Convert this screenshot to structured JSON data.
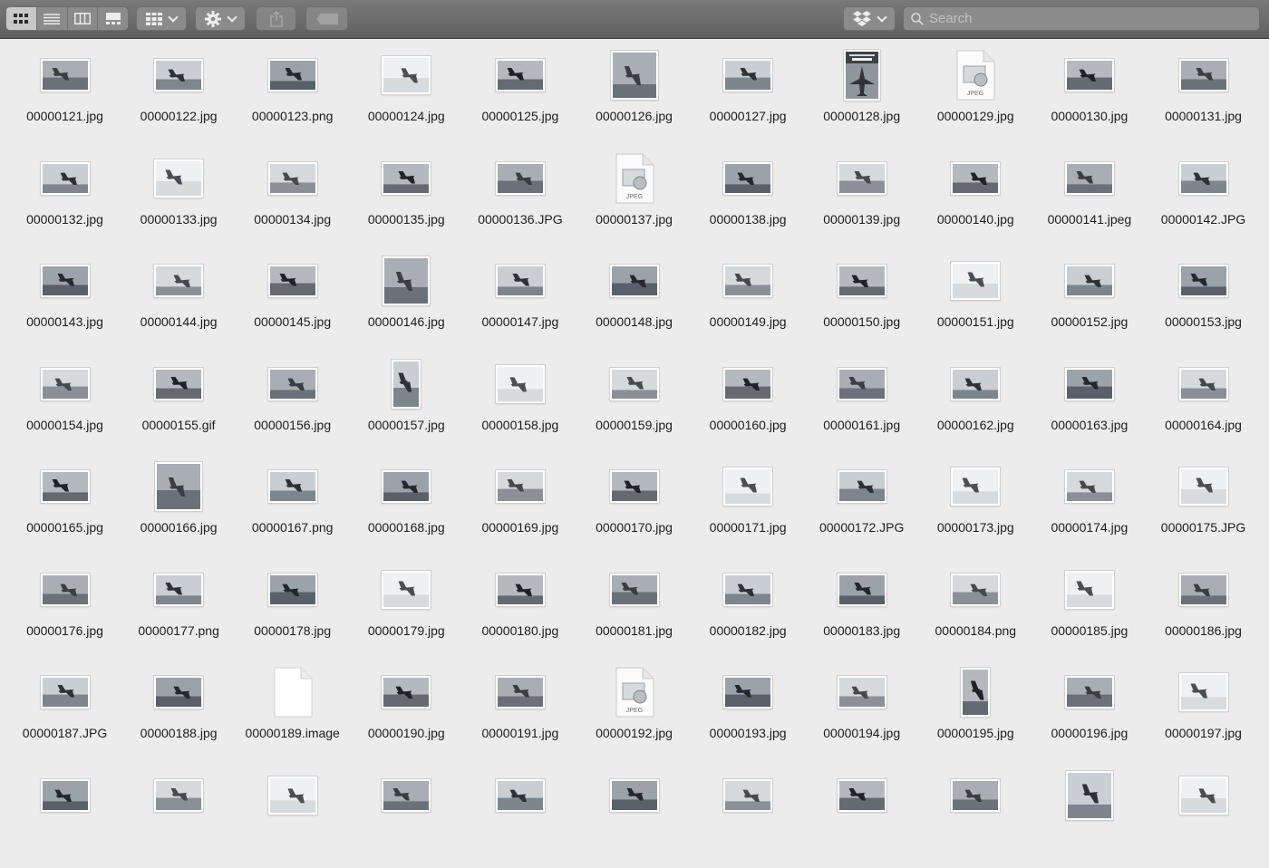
{
  "toolbar": {
    "view_modes": [
      {
        "name": "icon-view",
        "icon": "grid-icon",
        "selected": true
      },
      {
        "name": "list-view",
        "icon": "list-icon",
        "selected": false
      },
      {
        "name": "column-view",
        "icon": "columns-icon",
        "selected": false
      },
      {
        "name": "gallery-view",
        "icon": "gallery-icon",
        "selected": false
      }
    ],
    "group_icon": "group-grid-icon",
    "action_icon": "gear-icon",
    "share_icon": "share-icon",
    "tags_icon": "tag-icon",
    "dropbox_icon": "dropbox-icon",
    "search_placeholder": "Search"
  },
  "files": [
    {
      "name": "00000121.jpg",
      "kind": "photo"
    },
    {
      "name": "00000122.jpg",
      "kind": "photo"
    },
    {
      "name": "00000123.png",
      "kind": "photo"
    },
    {
      "name": "00000124.jpg",
      "kind": "photo-light"
    },
    {
      "name": "00000125.jpg",
      "kind": "photo"
    },
    {
      "name": "00000126.jpg",
      "kind": "photo-tall"
    },
    {
      "name": "00000127.jpg",
      "kind": "photo"
    },
    {
      "name": "00000128.jpg",
      "kind": "poster"
    },
    {
      "name": "00000129.jpg",
      "kind": "jpeg-doc"
    },
    {
      "name": "00000130.jpg",
      "kind": "photo"
    },
    {
      "name": "00000131.jpg",
      "kind": "photo"
    },
    {
      "name": "00000132.jpg",
      "kind": "photo"
    },
    {
      "name": "00000133.jpg",
      "kind": "photo-light"
    },
    {
      "name": "00000134.jpg",
      "kind": "photo"
    },
    {
      "name": "00000135.jpg",
      "kind": "photo"
    },
    {
      "name": "00000136.JPG",
      "kind": "photo"
    },
    {
      "name": "00000137.jpg",
      "kind": "jpeg-doc"
    },
    {
      "name": "00000138.jpg",
      "kind": "photo"
    },
    {
      "name": "00000139.jpg",
      "kind": "photo"
    },
    {
      "name": "00000140.jpg",
      "kind": "photo"
    },
    {
      "name": "00000141.jpeg",
      "kind": "photo"
    },
    {
      "name": "00000142.JPG",
      "kind": "photo"
    },
    {
      "name": "00000143.jpg",
      "kind": "photo"
    },
    {
      "name": "00000144.jpg",
      "kind": "photo"
    },
    {
      "name": "00000145.jpg",
      "kind": "photo"
    },
    {
      "name": "00000146.jpg",
      "kind": "photo-tall"
    },
    {
      "name": "00000147.jpg",
      "kind": "photo"
    },
    {
      "name": "00000148.jpg",
      "kind": "photo"
    },
    {
      "name": "00000149.jpg",
      "kind": "photo"
    },
    {
      "name": "00000150.jpg",
      "kind": "photo"
    },
    {
      "name": "00000151.jpg",
      "kind": "photo-light"
    },
    {
      "name": "00000152.jpg",
      "kind": "photo"
    },
    {
      "name": "00000153.jpg",
      "kind": "photo"
    },
    {
      "name": "00000154.jpg",
      "kind": "photo"
    },
    {
      "name": "00000155.gif",
      "kind": "photo"
    },
    {
      "name": "00000156.jpg",
      "kind": "photo"
    },
    {
      "name": "00000157.jpg",
      "kind": "photo-narrow"
    },
    {
      "name": "00000158.jpg",
      "kind": "photo-light"
    },
    {
      "name": "00000159.jpg",
      "kind": "photo"
    },
    {
      "name": "00000160.jpg",
      "kind": "photo"
    },
    {
      "name": "00000161.jpg",
      "kind": "photo"
    },
    {
      "name": "00000162.jpg",
      "kind": "photo"
    },
    {
      "name": "00000163.jpg",
      "kind": "photo"
    },
    {
      "name": "00000164.jpg",
      "kind": "photo"
    },
    {
      "name": "00000165.jpg",
      "kind": "photo"
    },
    {
      "name": "00000166.jpg",
      "kind": "photo-tall"
    },
    {
      "name": "00000167.png",
      "kind": "photo"
    },
    {
      "name": "00000168.jpg",
      "kind": "photo"
    },
    {
      "name": "00000169.jpg",
      "kind": "photo"
    },
    {
      "name": "00000170.jpg",
      "kind": "photo"
    },
    {
      "name": "00000171.jpg",
      "kind": "photo-light"
    },
    {
      "name": "00000172.JPG",
      "kind": "photo"
    },
    {
      "name": "00000173.jpg",
      "kind": "photo-light"
    },
    {
      "name": "00000174.jpg",
      "kind": "photo"
    },
    {
      "name": "00000175.JPG",
      "kind": "photo-light"
    },
    {
      "name": "00000176.jpg",
      "kind": "photo"
    },
    {
      "name": "00000177.png",
      "kind": "photo"
    },
    {
      "name": "00000178.jpg",
      "kind": "photo"
    },
    {
      "name": "00000179.jpg",
      "kind": "photo-light"
    },
    {
      "name": "00000180.jpg",
      "kind": "photo"
    },
    {
      "name": "00000181.jpg",
      "kind": "photo"
    },
    {
      "name": "00000182.jpg",
      "kind": "photo"
    },
    {
      "name": "00000183.jpg",
      "kind": "photo"
    },
    {
      "name": "00000184.png",
      "kind": "photo"
    },
    {
      "name": "00000185.jpg",
      "kind": "photo-light"
    },
    {
      "name": "00000186.jpg",
      "kind": "photo"
    },
    {
      "name": "00000187.JPG",
      "kind": "photo"
    },
    {
      "name": "00000188.jpg",
      "kind": "photo"
    },
    {
      "name": "00000189.image",
      "kind": "blank-doc"
    },
    {
      "name": "00000190.jpg",
      "kind": "photo"
    },
    {
      "name": "00000191.jpg",
      "kind": "photo"
    },
    {
      "name": "00000192.jpg",
      "kind": "jpeg-doc"
    },
    {
      "name": "00000193.jpg",
      "kind": "photo"
    },
    {
      "name": "00000194.jpg",
      "kind": "photo"
    },
    {
      "name": "00000195.jpg",
      "kind": "photo-narrow"
    },
    {
      "name": "00000196.jpg",
      "kind": "photo"
    },
    {
      "name": "00000197.jpg",
      "kind": "photo-light"
    },
    {
      "name": "",
      "kind": "photo"
    },
    {
      "name": "",
      "kind": "photo"
    },
    {
      "name": "",
      "kind": "photo-light"
    },
    {
      "name": "",
      "kind": "photo"
    },
    {
      "name": "",
      "kind": "photo"
    },
    {
      "name": "",
      "kind": "photo"
    },
    {
      "name": "",
      "kind": "photo"
    },
    {
      "name": "",
      "kind": "photo"
    },
    {
      "name": "",
      "kind": "photo"
    },
    {
      "name": "",
      "kind": "photo-tall"
    },
    {
      "name": "",
      "kind": "photo-light"
    }
  ]
}
